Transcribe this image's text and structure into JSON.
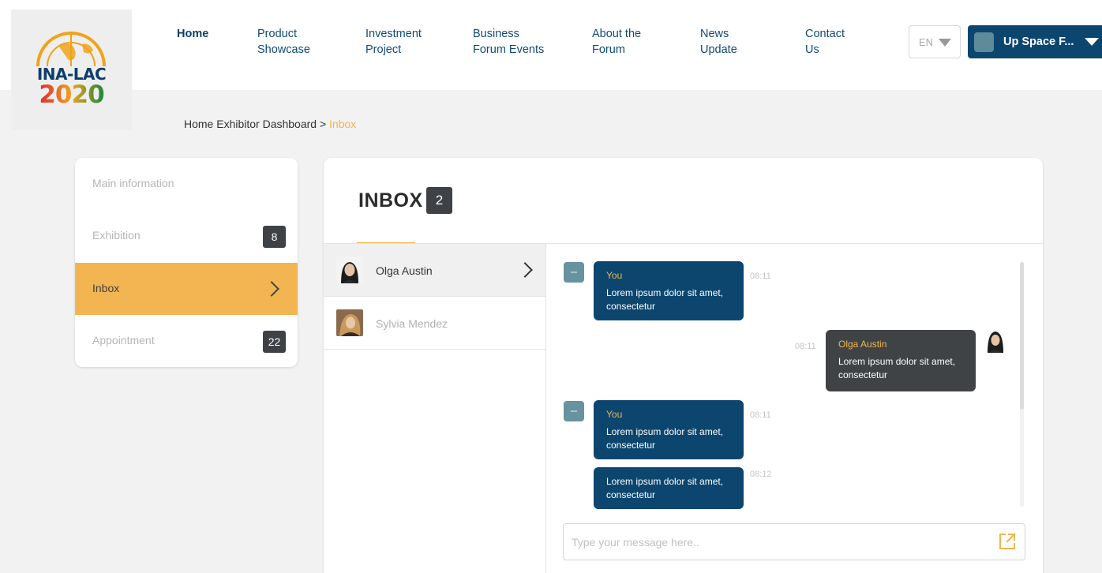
{
  "logo": {
    "line1": "INA-LAC",
    "line2": "2020"
  },
  "nav": {
    "items": [
      {
        "label": "Home",
        "active": true
      },
      {
        "label": "Product\nShowcase"
      },
      {
        "label": "Investment\nProject"
      },
      {
        "label": "Business\nForum Events"
      },
      {
        "label": "About the\nForum"
      },
      {
        "label": "News\nUpdate"
      },
      {
        "label": "Contact\nUs"
      }
    ],
    "language": "EN",
    "user_label": "Up Space F..."
  },
  "breadcrumb": {
    "trail": "Home Exhibitor Dashboard >",
    "current": "Inbox"
  },
  "sidebar": {
    "items": [
      {
        "label": "Main information"
      },
      {
        "label": "Exhibition",
        "badge": "8"
      },
      {
        "label": "Inbox",
        "active": true
      },
      {
        "label": "Appointment",
        "badge": "22"
      }
    ]
  },
  "inbox": {
    "title": "INBOX",
    "count": "2",
    "contacts": [
      {
        "name": "Olga Austin",
        "active": true
      },
      {
        "name": "Sylvia Mendez"
      }
    ],
    "messages": [
      {
        "from": "You",
        "text": "Lorem ipsum dolor sit amet, consectetur",
        "time": "08:11"
      },
      {
        "from": "Olga Austin",
        "text": "Lorem ipsum dolor sit amet, consectetur",
        "time": "08:11"
      },
      {
        "from": "You",
        "text": "Lorem ipsum dolor sit amet, consectetur",
        "time": "08:11"
      },
      {
        "from": "",
        "text": "Lorem ipsum dolor sit amet, consectetur",
        "time": "08:12"
      }
    ],
    "composer_placeholder": "Type your message here.."
  },
  "colors": {
    "navy": "#0c466f",
    "accent": "#f2b551",
    "dark": "#404346"
  }
}
